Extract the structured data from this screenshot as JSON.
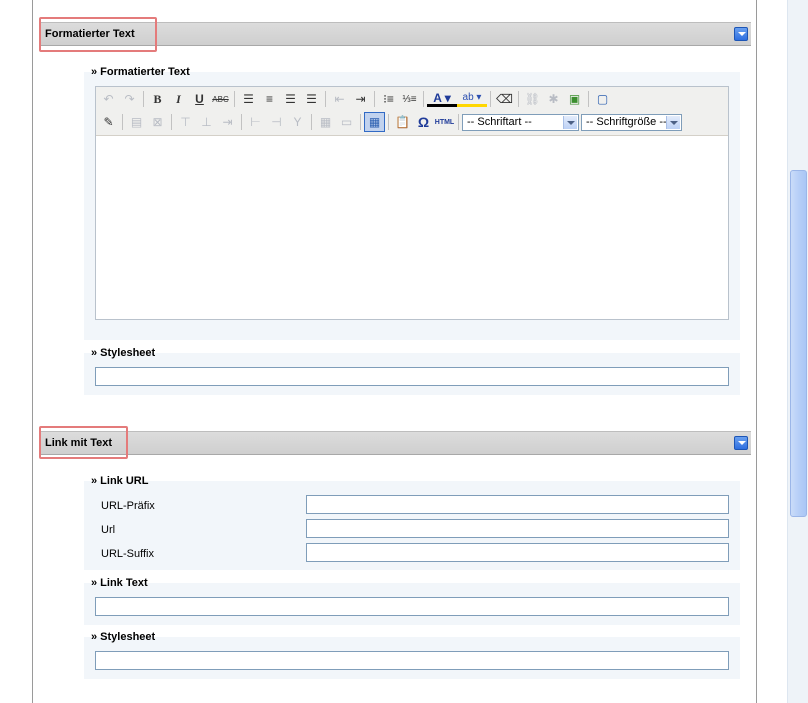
{
  "sections": [
    {
      "title": "Formatierter Text",
      "fields": [
        {
          "label": "» Formatierter Text",
          "editor": {
            "font_select": "-- Schriftart --",
            "size_select": "-- Schriftgröße --",
            "special_char": "Ω",
            "html_label": "HTML"
          }
        },
        {
          "label": "» Stylesheet",
          "value": ""
        }
      ]
    },
    {
      "title": "Link mit Text",
      "fields": [
        {
          "label": "» Link URL",
          "subfields": [
            {
              "label": "URL-Präfix",
              "value": ""
            },
            {
              "label": "Url",
              "value": ""
            },
            {
              "label": "URL-Suffix",
              "value": ""
            }
          ]
        },
        {
          "label": "» Link Text",
          "value": ""
        },
        {
          "label": "» Stylesheet",
          "value": ""
        }
      ]
    }
  ],
  "toolbar_icons": {
    "row1": [
      "undo-icon",
      "redo-icon",
      "bold-icon",
      "italic-icon",
      "underline-icon",
      "strikethrough-icon",
      "align-left-icon",
      "align-center-icon",
      "align-right-icon",
      "align-justify-icon",
      "outdent-icon",
      "indent-icon",
      "bullet-list-icon",
      "numbered-list-icon",
      "text-color-icon",
      "highlight-color-icon",
      "remove-format-icon",
      "link-icon",
      "unlink-icon",
      "image-icon",
      "fullscreen-icon"
    ],
    "row2": [
      "edit-css-icon",
      "insert-table-icon",
      "delete-table-icon",
      "insert-row-before-icon",
      "insert-row-after-icon",
      "delete-row-icon",
      "insert-col-before-icon",
      "insert-col-after-icon",
      "delete-col-icon",
      "split-cells-icon",
      "merge-cells-icon",
      "table-grid-icon",
      "paste-word-icon",
      "special-char-icon",
      "html-source-icon"
    ]
  },
  "colors": {
    "header_bg": "#d4d0d0",
    "highlight": "#e47b7b",
    "collapse_btn": "#2f6fe0",
    "input_border": "#7f9db9",
    "panel_bg": "#f2f6fa"
  }
}
